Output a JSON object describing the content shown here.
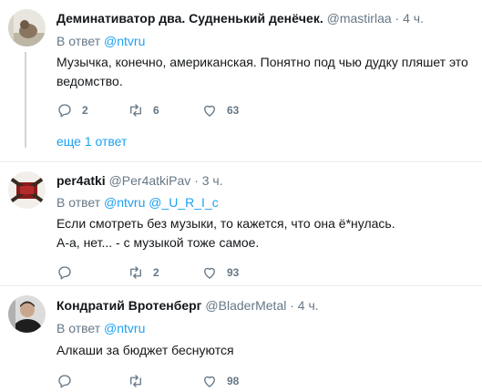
{
  "tweets": [
    {
      "name": "Деминативатор два. Судненький денёчек.",
      "handle": "@mastirlaa",
      "dot": "·",
      "time": "4 ч.",
      "reply_prefix": "В ответ",
      "mentions": [
        "@ntvru"
      ],
      "text_lines": [
        "Музычка, конечно, американская. Понятно под чью дудку пляшет это",
        "ведомство."
      ],
      "replies": "2",
      "retweets": "6",
      "likes": "63"
    },
    {
      "name": "per4atki",
      "handle": "@Per4atkiPav",
      "dot": "·",
      "time": "3 ч.",
      "reply_prefix": "В ответ",
      "mentions": [
        "@ntvru",
        "@_U_R_I_c"
      ],
      "text_lines": [
        "Если смотреть без музыки, то кажется, что она ё*нулась.",
        "А-а, нет... - с музыкой тоже самое."
      ],
      "replies": "",
      "retweets": "2",
      "likes": "93"
    },
    {
      "name": "Кондратий Вротенберг",
      "handle": "@BladerMetal",
      "dot": "·",
      "time": "4 ч.",
      "reply_prefix": "В ответ",
      "mentions": [
        "@ntvru"
      ],
      "text_lines": [
        "Алкаши за бюджет беснуются"
      ],
      "replies": "",
      "retweets": "",
      "likes": "98"
    }
  ],
  "more_replies": "еще 1 ответ",
  "colors": {
    "link": "#1da1f2",
    "muted": "#657786",
    "divider": "#e6ecf0"
  }
}
